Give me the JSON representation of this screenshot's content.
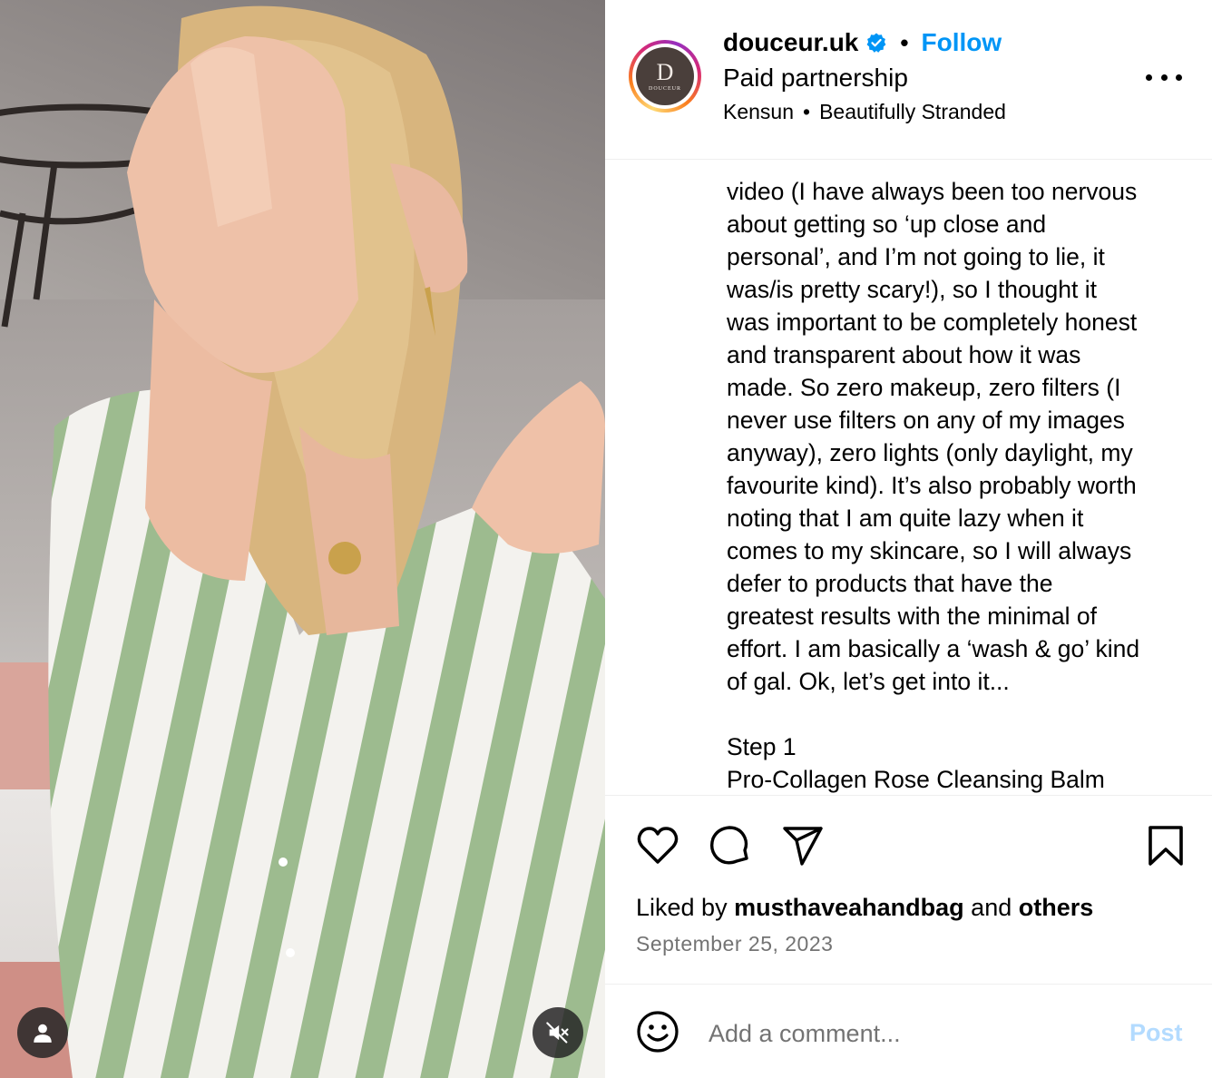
{
  "media": {
    "user_tag_icon": "person-icon",
    "mute_icon": "speaker-muted-icon"
  },
  "post": {
    "username": "douceur.uk",
    "verified": true,
    "separator": "•",
    "follow_label": "Follow",
    "subtitle": "Paid partnership",
    "audio_artist": "Kensun",
    "audio_separator": "•",
    "audio_track": "Beautifully Stranded",
    "avatar_letter": "D",
    "avatar_wordmark": "DOUCEUR",
    "more_icon": "more-horizontal-icon"
  },
  "caption": {
    "lines": [
      "video (I have always been too nervous",
      "about getting so ‘up close and",
      "personal’, and I’m not going to lie, it",
      "was/is pretty scary!), so I thought it",
      "was important to be completely honest",
      "and transparent about how it was",
      "made. So zero makeup, zero filters (I",
      "never use filters on any of my images",
      "anyway), zero lights (only daylight, my",
      "favourite kind). It’s also probably worth",
      "noting that I am quite lazy when it",
      "comes to my skincare, so I will always",
      "defer to products that have the",
      "greatest results with the minimal of",
      "effort. I am basically a ‘wash & go’ kind",
      "of gal. Ok, let’s get into it..."
    ],
    "step_label": "Step 1",
    "step_product": "Pro-Collagen Rose Cleansing Balm"
  },
  "actions": {
    "like_icon": "heart-icon",
    "comment_icon": "comment-icon",
    "share_icon": "send-icon",
    "save_icon": "bookmark-icon"
  },
  "likes": {
    "prefix": "Liked by",
    "user": "musthaveahandbag",
    "and": "and",
    "others": "others"
  },
  "date": "September 25, 2023",
  "comment": {
    "emoji_icon": "emoji-icon",
    "placeholder": "Add a comment...",
    "post_label": "Post"
  },
  "colors": {
    "accent": "#0095f6",
    "post_disabled": "#b3dbff",
    "muted_text": "#737373",
    "verified_badge": "#0095f6"
  }
}
